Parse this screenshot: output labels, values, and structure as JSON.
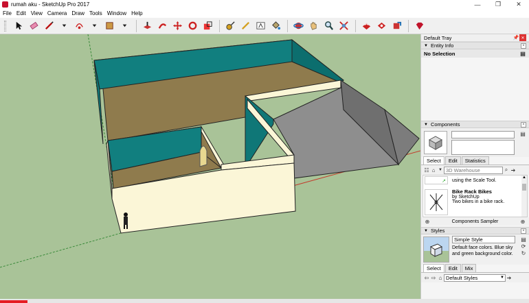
{
  "window": {
    "title": "rumah aku - SketchUp Pro 2017",
    "minimize": "—",
    "restore": "❐",
    "close": "✕"
  },
  "menu": [
    "File",
    "Edit",
    "View",
    "Camera",
    "Draw",
    "Tools",
    "Window",
    "Help"
  ],
  "tray": {
    "title": "Default Tray",
    "pin": "📌",
    "close": "✕",
    "entity_info": {
      "header": "Entity Info",
      "selection": "No Selection"
    },
    "components": {
      "header": "Components",
      "tabs": [
        "Select",
        "Edit",
        "Statistics"
      ],
      "search_placeholder": "3D Warehouse",
      "partial_text": "using the Scale Tool.",
      "item_title": "Bike Rack Bikes",
      "item_author": "by SketchUp",
      "item_desc": "Two bikes in a bike rack.",
      "footer": "Components Sampler"
    },
    "styles": {
      "header": "Styles",
      "name": "Simple Style",
      "desc": "Default face colors. Blue sky and green background color.",
      "tabs": [
        "Select",
        "Edit",
        "Mix"
      ],
      "collection": "Default Styles"
    }
  },
  "colors": {
    "ground": "#a9c398",
    "wall_teal": "#117f7f",
    "wall_cream": "#fbf6d7",
    "floor_brown": "#8f7b4d",
    "gray": "#8e8e8e"
  }
}
